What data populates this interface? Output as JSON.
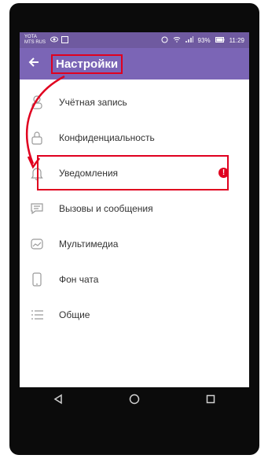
{
  "window": {
    "controls": [
      "external-link-icon",
      "close-icon"
    ]
  },
  "status_bar": {
    "carrier1": "YOTA",
    "carrier2": "MTS RUS",
    "battery": "93%",
    "time": "11:29"
  },
  "header": {
    "title": "Настройки"
  },
  "menu": {
    "items": [
      {
        "label": "Учётная запись",
        "icon": "account-icon"
      },
      {
        "label": "Конфиденциальность",
        "icon": "lock-icon"
      },
      {
        "label": "Уведомления",
        "icon": "bell-icon",
        "badge": "!"
      },
      {
        "label": "Вызовы и сообщения",
        "icon": "chat-icon"
      },
      {
        "label": "Мультимедиа",
        "icon": "media-icon"
      },
      {
        "label": "Фон чата",
        "icon": "phone-icon"
      },
      {
        "label": "Общие",
        "icon": "list-icon"
      }
    ]
  },
  "colors": {
    "status_purple": "#6f5aa0",
    "appbar_purple": "#7b65b6",
    "highlight_red": "#e0001f"
  }
}
